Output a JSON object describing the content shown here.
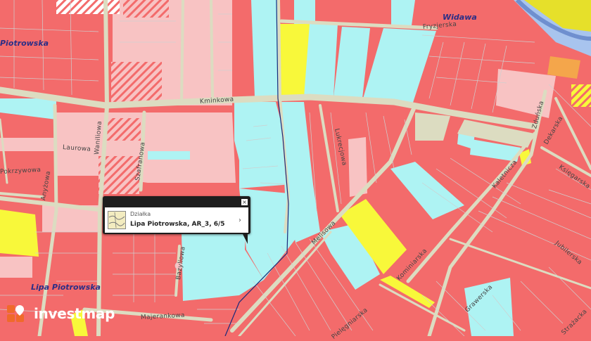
{
  "map": {
    "places": [
      "Widawa",
      "Piotrowska",
      "Lipa Piotrowska"
    ],
    "streets": [
      "Fryzjerska",
      "Kminkowa",
      "Waniliowa",
      "Laurowa",
      "Szafranowa",
      "Anyżowa",
      "Pokrzywowa",
      "Lukrecjowa",
      "Melisowa",
      "Kominiarska",
      "Kaletnicza",
      "Zduńska",
      "Dekarska",
      "Księgarska",
      "Jubilerska",
      "Grawerska",
      "Bazyliowa",
      "Majerankowa",
      "Pielęgniarska",
      "Strażacka"
    ]
  },
  "popup": {
    "type_label": "Działka",
    "title": "Lipa Piotrowska, AR_3, 6/5",
    "close_label": "×",
    "arrow_label": "›"
  },
  "logo": {
    "brand": "investmap"
  },
  "colors": {
    "residential": "#f36b6b",
    "services": "#aef3f3",
    "green": "#f8f83a",
    "light_pink": "#f8c3c3",
    "road": "#dcdcc1",
    "water": "#a8c4ee",
    "orange": "#f4a64b"
  }
}
